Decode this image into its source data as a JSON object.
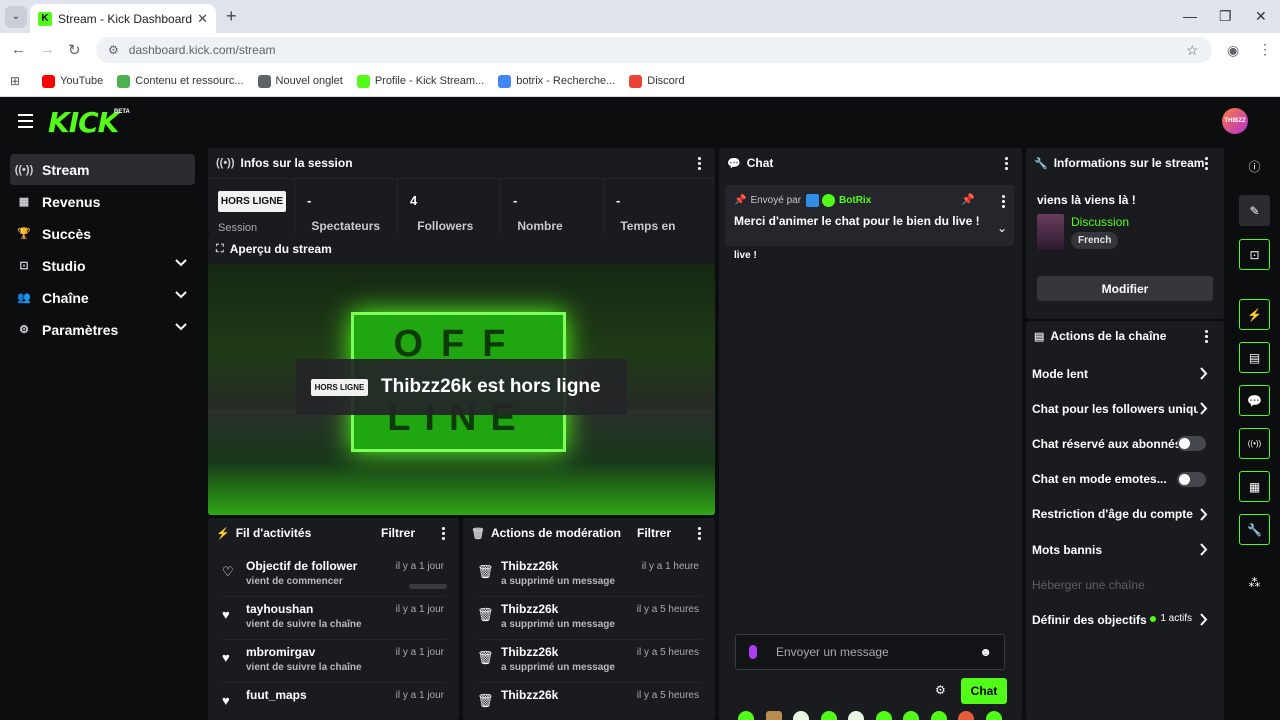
{
  "browser": {
    "tab_title": "Stream - Kick Dashboard",
    "url": "dashboard.kick.com/stream",
    "bookmarks": [
      {
        "label": "YouTube",
        "color": "#ff0000"
      },
      {
        "label": "Contenu et ressourc...",
        "color": "#4caf50"
      },
      {
        "label": "Nouvel onglet",
        "color": "#5f6368"
      },
      {
        "label": "Profile - Kick Stream...",
        "color": "#53fc18"
      },
      {
        "label": "botrix - Recherche...",
        "color": "#4285f4"
      },
      {
        "label": "Discord",
        "color": "#ea4335"
      }
    ]
  },
  "app": {
    "logo": "KICK",
    "beta": "BETA",
    "avatar_text": "THIBZZ",
    "accent": "#53fc18"
  },
  "sidebar": {
    "items": [
      {
        "label": "Stream",
        "icon": "broadcast-icon",
        "active": true,
        "expandable": false
      },
      {
        "label": "Revenus",
        "icon": "chart-icon",
        "active": false,
        "expandable": false
      },
      {
        "label": "Succès",
        "icon": "trophy-icon",
        "active": false,
        "expandable": false
      },
      {
        "label": "Studio",
        "icon": "studio-icon",
        "active": false,
        "expandable": true
      },
      {
        "label": "Chaîne",
        "icon": "users-icon",
        "active": false,
        "expandable": true
      },
      {
        "label": "Paramètres",
        "icon": "gear-icon",
        "active": false,
        "expandable": true
      }
    ]
  },
  "session": {
    "title": "Infos sur la session",
    "status_badge": "HORS LIGNE",
    "status_sub": "Session",
    "stats": [
      {
        "value": "-",
        "label": "Spectateurs"
      },
      {
        "value": "4",
        "label": "Followers"
      },
      {
        "value": "-",
        "label": "Nombre"
      },
      {
        "value": "-",
        "label": "Temps en"
      }
    ]
  },
  "preview": {
    "title": "Aperçu du stream",
    "badge": "HORS LIGNE",
    "message": "Thibzz26k est hors ligne",
    "offline_top": "OFF",
    "offline_bottom": "LINE"
  },
  "activity": {
    "title": "Fil d'activités",
    "filter": "Filtrer",
    "items": [
      {
        "title": "Objectif de follower",
        "sub": "vient de commencer",
        "time": "il y a 1 jour",
        "icon": "heart-outline-icon"
      },
      {
        "title": "tayhoushan",
        "sub": "vient de suivre la chaîne",
        "time": "il y a 1 jour",
        "icon": "heart-icon"
      },
      {
        "title": "mbromirgav",
        "sub": "vient de suivre la chaîne",
        "time": "il y a 1 jour",
        "icon": "heart-icon"
      },
      {
        "title": "fuut_maps",
        "sub": "",
        "time": "il y a 1 jour",
        "icon": "heart-icon"
      }
    ]
  },
  "moderation": {
    "title": "Actions de modération",
    "filter": "Filtrer",
    "items": [
      {
        "title": "Thibzz26k",
        "sub": "a supprimé un message",
        "time": "il y a 1 heure"
      },
      {
        "title": "Thibzz26k",
        "sub": "a supprimé un message",
        "time": "il y a 5 heures"
      },
      {
        "title": "Thibzz26k",
        "sub": "a supprimé un message",
        "time": "il y a 5 heures"
      },
      {
        "title": "Thibzz26k",
        "sub": "",
        "time": "il y a 5 heures"
      }
    ]
  },
  "chat": {
    "title": "Chat",
    "pinned_prefix": "Envoyé par",
    "pinned_author": "BotRix",
    "pinned_message": "Merci d'animer le chat pour le bien du live !",
    "overflow_text": "live !",
    "input_placeholder": "Envoyer un message",
    "send_label": "Chat"
  },
  "stream_info": {
    "title": "Informations sur le stream",
    "stream_title": "viens là viens là !",
    "category": "Discussion",
    "language": "French",
    "edit_label": "Modifier"
  },
  "channel_actions": {
    "title": "Actions de la chaîne",
    "items": [
      {
        "label": "Mode lent",
        "type": "arrow"
      },
      {
        "label": "Chat pour les followers uniquement",
        "type": "arrow"
      },
      {
        "label": "Chat réservé aux abonnés",
        "type": "toggle"
      },
      {
        "label": "Chat en mode emotes...",
        "type": "toggle"
      },
      {
        "label": "Restriction d'âge du compte",
        "type": "arrow"
      },
      {
        "label": "Mots bannis",
        "type": "arrow"
      },
      {
        "label": "Héberger une chaîne",
        "type": "disabled"
      },
      {
        "label": "Définir des objectifs",
        "type": "goals",
        "badge": "1 actifs"
      }
    ]
  },
  "rail": {
    "icons": [
      "info-icon",
      "pencil-icon",
      "camera-icon",
      "bolt-icon",
      "notes-icon",
      "chat-bubble-icon",
      "broadcast-icon",
      "layout-icon",
      "wrench-icon",
      "apps-icon"
    ]
  }
}
